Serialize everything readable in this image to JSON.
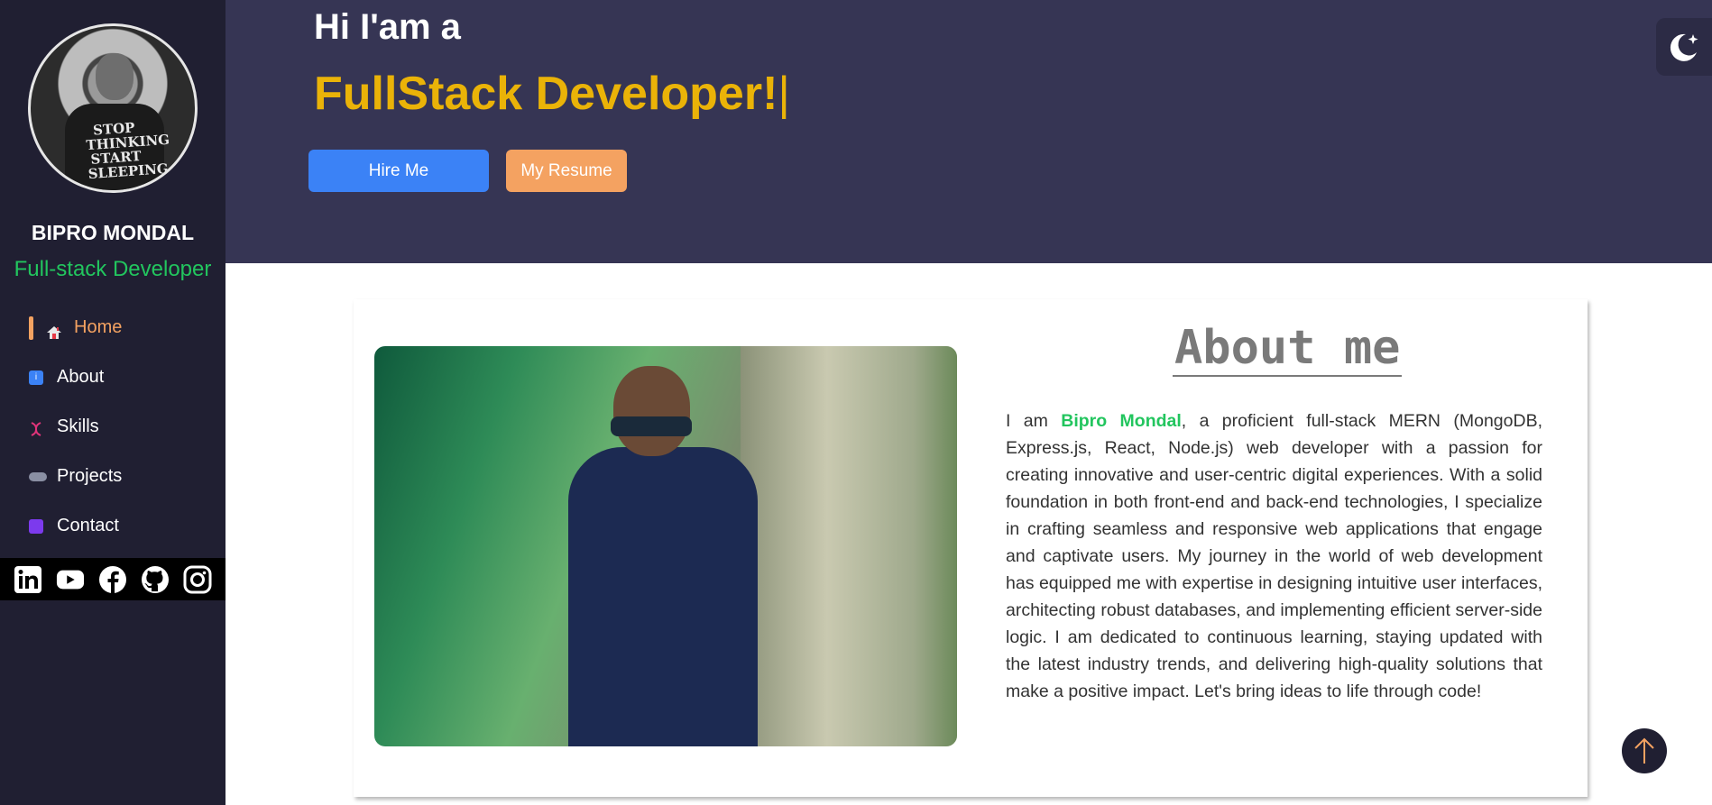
{
  "sidebar": {
    "name": "BIPRO MONDAL",
    "role": "Full-stack Developer",
    "avatar_text": "STOP THINKING START SLEEPING",
    "nav": [
      {
        "label": "Home",
        "icon": "home-icon",
        "active": true
      },
      {
        "label": "About",
        "icon": "info-icon",
        "active": false
      },
      {
        "label": "Skills",
        "icon": "dna-icon",
        "active": false
      },
      {
        "label": "Projects",
        "icon": "gamepad-icon",
        "active": false
      },
      {
        "label": "Contact",
        "icon": "contact-card-icon",
        "active": false
      }
    ],
    "social": [
      "linkedin-icon",
      "youtube-icon",
      "facebook-icon",
      "github-icon",
      "instagram-icon"
    ]
  },
  "hero": {
    "greeting": "Hi I'am a",
    "title": "FullStack Developer!",
    "cursor": "|",
    "hire_label": "Hire Me",
    "resume_label": "My Resume"
  },
  "about": {
    "heading": "About me",
    "intro": "I am",
    "highlight": "Bipro Mondal",
    "body": ", a proficient full-stack MERN (MongoDB, Express.js, React, Node.js) web developer with a passion for creating innovative and user-centric digital experiences. With a solid foundation in both front-end and back-end technologies, I specialize in crafting seamless and responsive web applications that engage and captivate users. My journey in the world of web development has equipped me with expertise in designing intuitive user interfaces, architecting robust databases, and implementing efficient server-side logic. I am dedicated to continuous learning, staying updated with the latest industry trends, and delivering high-quality solutions that make a positive impact. Let's bring ideas to life through code!"
  },
  "colors": {
    "sidebar_bg": "#201f32",
    "hero_bg": "#363554",
    "accent_yellow": "#eab308",
    "accent_green": "#22c55e",
    "accent_orange": "#f4a261",
    "accent_blue": "#3b82f6"
  }
}
